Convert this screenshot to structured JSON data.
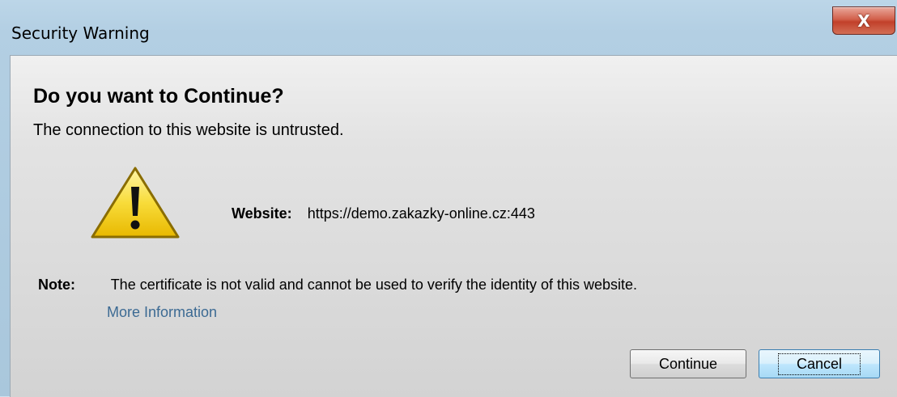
{
  "window": {
    "title": "Security Warning",
    "close_glyph": "X"
  },
  "dialog": {
    "heading": "Do you want to Continue?",
    "subheading": "The connection to this website is untrusted.",
    "icon": "warning-icon",
    "website_label": "Website:",
    "website_value": "https://demo.zakazky-online.cz:443",
    "note_label": "Note:",
    "note_text": "The certificate is not valid and cannot be used to verify the identity of this website.",
    "more_info_link": "More Information"
  },
  "buttons": {
    "continue_label": "Continue",
    "cancel_label": "Cancel"
  },
  "colors": {
    "link": "#3c6a93",
    "close_button": "#c1402a",
    "focused_button_border": "#3c7fb1"
  }
}
